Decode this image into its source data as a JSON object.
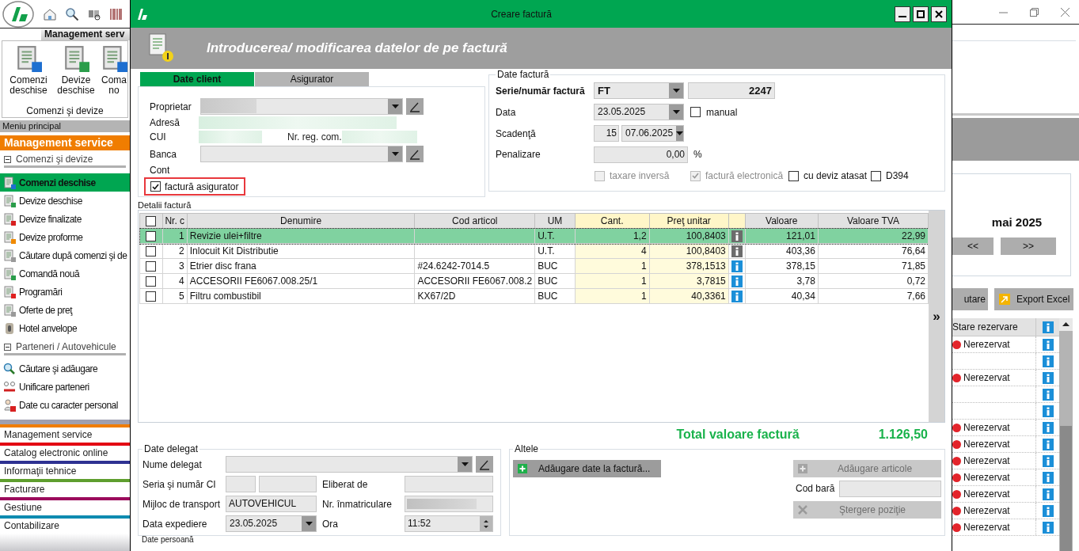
{
  "sidebar": {
    "ribbon_tab": "Management serv",
    "ribbon_buttons": [
      {
        "label": "Comenzi deschise"
      },
      {
        "label": "Devize deschise"
      },
      {
        "label": "Coma no"
      }
    ],
    "ribbon_group": "Comenzi şi devize",
    "menu_header": "Meniu principal",
    "module_title": "Management service",
    "sections": [
      {
        "title": "Comenzi şi devize",
        "expanded": true,
        "items": [
          {
            "label": "Comenzi deschise",
            "selected": true
          },
          {
            "label": "Devize deschise",
            "selected": false
          },
          {
            "label": "Devize finalizate",
            "selected": false
          },
          {
            "label": "Devize proforme",
            "selected": false
          },
          {
            "label": "Căutare după comenzi şi de",
            "selected": false
          },
          {
            "label": "Comandă nouă",
            "selected": false
          },
          {
            "label": "Programări",
            "selected": false
          },
          {
            "label": "Oferte de preţ",
            "selected": false
          },
          {
            "label": "Hotel anvelope",
            "selected": false
          }
        ]
      },
      {
        "title": "Parteneri / Autovehicule",
        "expanded": true,
        "items": [
          {
            "label": "Căutare şi adăugare",
            "selected": false
          },
          {
            "label": "Unificare parteneri",
            "selected": false
          },
          {
            "label": "Date cu caracter personal",
            "selected": false
          }
        ]
      }
    ],
    "modules": [
      {
        "label": "Management service",
        "color": "#f07d00"
      },
      {
        "label": "Catalog electronic online",
        "color": "#e30613"
      },
      {
        "label": "Informaţii tehnice",
        "color": "#2e3192"
      },
      {
        "label": "Facturare",
        "color": "#5e9e2e"
      },
      {
        "label": "Gestiune",
        "color": "#9b0a5c"
      },
      {
        "label": "Contabilizare",
        "color": "#0e8bb0"
      }
    ]
  },
  "dialog": {
    "title": "Creare factură",
    "heading": "Introducerea/ modificarea datelor de pe factură",
    "tabs": [
      {
        "label": "Date client",
        "selected": true
      },
      {
        "label": "Asigurator",
        "selected": false
      }
    ],
    "client": {
      "owner_label": "Proprietar",
      "address_label": "Adresă",
      "cui_label": "CUI",
      "reg_label": "Nr. reg. com.",
      "bank_label": "Banca",
      "account_label": "Cont",
      "insurer_invoice": {
        "label": "factură asigurator",
        "checked": true
      }
    },
    "invoice": {
      "title": "Date factură",
      "series_label": "Serie/număr factură",
      "series": "FT",
      "number": "2247",
      "date_label": "Data",
      "date": "23.05.2025",
      "manual": {
        "label": "manual",
        "checked": false
      },
      "due_label": "Scadenţă",
      "due_days": "15",
      "due_date": "07.06.2025",
      "penalty_label": "Penalizare",
      "penalty": "0,00",
      "penalty_unit": "%",
      "options": [
        {
          "label": "taxare inversă",
          "checked": false,
          "disabled": true
        },
        {
          "label": "factură electronică",
          "checked": true,
          "disabled": true
        },
        {
          "label": "cu deviz atasat",
          "checked": false,
          "disabled": false
        },
        {
          "label": "D394",
          "checked": false,
          "disabled": false
        }
      ]
    },
    "details": {
      "title": "Detalii factură",
      "header_checked": false,
      "columns": {
        "nr": "Nr. c",
        "name": "Denumire",
        "code": "Cod articol",
        "um": "UM",
        "qty": "Cant.",
        "price": "Preţ unitar",
        "value": "Valoare",
        "vat": "Valoare TVA"
      },
      "rows": [
        {
          "nr": "1",
          "name": "Revizie ulei+filtre",
          "um": "U.T.",
          "qty": "1,2",
          "price": "100,8403",
          "value": "121,01",
          "vat": "22,99",
          "selected": true,
          "checked": false,
          "info_enabled": false
        },
        {
          "nr": "2",
          "name": "Inlocuit Kit Distributie",
          "um": "U.T.",
          "qty": "4",
          "price": "100,8403",
          "value": "403,36",
          "vat": "76,64",
          "selected": false,
          "checked": false,
          "info_enabled": false
        },
        {
          "nr": "3",
          "name": "Etrier disc frana",
          "code": "#24.6242-7014.5",
          "um": "BUC",
          "qty": "1",
          "price": "378,1513",
          "value": "378,15",
          "vat": "71,85",
          "selected": false,
          "checked": false,
          "info_enabled": true
        },
        {
          "nr": "4",
          "name": "ACCESORII FE6067.008.25/1",
          "code": "ACCESORII FE6067.008.2",
          "um": "BUC",
          "qty": "1",
          "price": "3,7815",
          "value": "3,78",
          "vat": "0,72",
          "selected": false,
          "checked": false,
          "info_enabled": true
        },
        {
          "nr": "5",
          "name": "Filtru combustibil",
          "code": "KX67/2D",
          "um": "BUC",
          "qty": "1",
          "price": "40,3361",
          "value": "40,34",
          "vat": "7,66",
          "selected": false,
          "checked": false,
          "info_enabled": true
        }
      ],
      "expand": "»"
    },
    "total": {
      "label": "Total valoare factură",
      "value": "1.126,50"
    },
    "delegate": {
      "title": "Date delegat",
      "name_label": "Nume delegat",
      "id_label": "Seria şi număr CI",
      "issued_label": "Eliberat de",
      "transport_label": "Mijloc de transport",
      "transport": "AUTOVEHICUL",
      "plate_label": "Nr. înmatriculare",
      "ship_date_label": "Data expediere",
      "ship_date": "23.05.2025",
      "time_label": "Ora",
      "time": "11:52"
    },
    "other": {
      "title": "Altele",
      "add_data": "Adăugare date la factură...",
      "add_items": "Adăugare articole",
      "barcode_label": "Cod bară",
      "delete": "Ştergere poziţie"
    },
    "next_group": "Date persoană"
  },
  "background": {
    "calendar_title": "mai 2025",
    "prev": "<<",
    "next": ">>",
    "search_button": "utare",
    "export_button": "Export Excel",
    "reservations": {
      "header": "Stare rezervare",
      "rows": [
        {
          "kind": "status",
          "status": "Nerezervat",
          "color": "#e3242b"
        },
        {
          "kind": "blank"
        },
        {
          "kind": "status",
          "status": "Nerezervat",
          "color": "#e3242b"
        },
        {
          "kind": "blank"
        },
        {
          "kind": "blank"
        },
        {
          "kind": "status",
          "status": "Nerezervat",
          "color": "#e3242b"
        },
        {
          "kind": "status",
          "status": "Nerezervat",
          "color": "#e3242b"
        },
        {
          "kind": "status",
          "status": "Nerezervat",
          "color": "#e3242b"
        },
        {
          "kind": "status",
          "status": "Nerezervat",
          "color": "#e3242b"
        },
        {
          "kind": "status",
          "status": "Nerezervat",
          "color": "#e3242b"
        },
        {
          "kind": "status",
          "status": "Nerezervat",
          "color": "#e3242b"
        },
        {
          "kind": "status",
          "status": "Nerezervat",
          "color": "#e3242b"
        }
      ]
    }
  }
}
